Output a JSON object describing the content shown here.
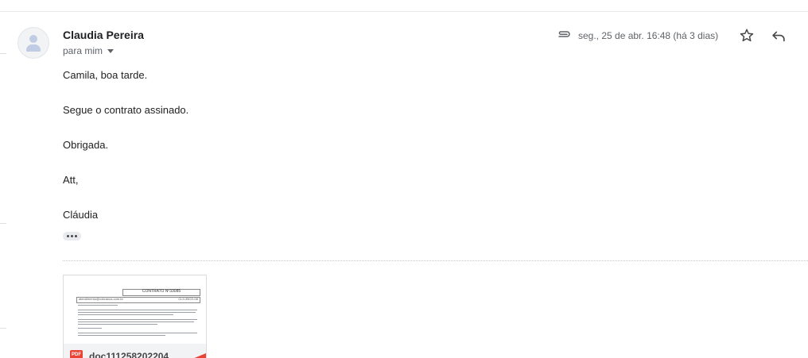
{
  "email": {
    "sender_name": "Claudia Pereira",
    "recipients_label": "para mim",
    "date_text": "seg., 25 de abr. 16:48 (há 3 dias)",
    "body_lines": [
      "Camila, boa tarde.",
      "Segue o contrato assinado.",
      "Obrigada.",
      "Att,",
      "Cláudia"
    ]
  },
  "icons": {
    "avatar": "person-icon",
    "attachment": "paperclip-icon",
    "star": "star-outline-icon",
    "reply": "reply-icon",
    "expand": "more-horizontal-icon",
    "file_type": "pdf-icon"
  },
  "attachment": {
    "file_name": "doc111258202204",
    "file_type_label": "PDF",
    "preview": {
      "title": "CONTRATO Nº33085",
      "header_left": "atendimento@cobranca.com.br",
      "header_right": "CL3-35CD-08"
    }
  },
  "colors": {
    "pdf_red": "#ea4335",
    "body_text": "#222222",
    "secondary_text": "#5f6368"
  }
}
